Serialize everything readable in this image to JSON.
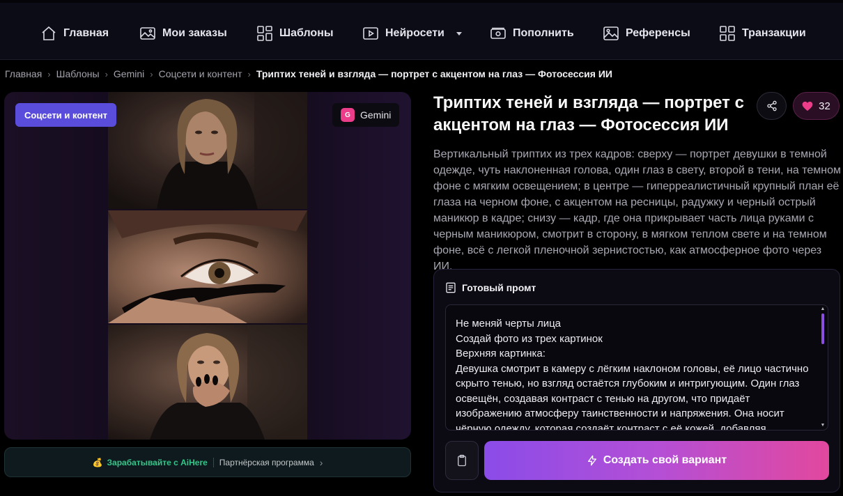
{
  "nav": {
    "items": [
      {
        "label": "Главная",
        "icon": "home-icon"
      },
      {
        "label": "Мои заказы",
        "icon": "image-icon"
      },
      {
        "label": "Шаблоны",
        "icon": "grid-icon"
      },
      {
        "label": "Нейросети",
        "icon": "play-icon",
        "has_dropdown": true
      },
      {
        "label": "Пополнить",
        "icon": "wallet-icon"
      },
      {
        "label": "Референсы",
        "icon": "picture-icon"
      },
      {
        "label": "Транзакции",
        "icon": "grid-icon"
      }
    ]
  },
  "breadcrumb": {
    "items": [
      "Главная",
      "Шаблоны",
      "Gemini",
      "Соцсети и контент"
    ],
    "current": "Триптих теней и взгляда — портрет с акцентом на глаз — Фотосессия ИИ"
  },
  "image_panel": {
    "category_chip": "Соцсети и контент",
    "model_badge": {
      "letter": "G",
      "label": "Gemini"
    },
    "partner": {
      "coin": "💰",
      "earn_label": "Зарабатывайте с AiHere",
      "program_label": "Партнёрская программа",
      "arrow": "›"
    }
  },
  "template": {
    "title": "Триптих теней и взгляда — портрет с акцентом на глаз — Фотосессия ИИ",
    "likes": "32",
    "description": "Вертикальный триптих из трех кадров: сверху — портрет девушки в темной одежде, чуть наклоненная голова, один глаз в свету, второй в тени, на темном фоне с мягким освещением; в центре — гиперреалистичный крупный план её глаза на черном фоне, с акцентом на ресницы, радужку и черный острый маникюр в кадре; снизу — кадр, где она прикрывает часть лица руками с черным маникюром, смотрит в сторону, в мягком теплом свете и на темном фоне, всё с легкой пленочной зернистостью, как атмосферное фото через ИИ."
  },
  "prompt": {
    "heading": "Готовый промт",
    "text": "Не меняй черты лица\nСоздай фото из трех картинок\nВерхняя картинка:\nДевушка смотрит в камеру с лёгким наклоном головы, её лицо частично скрыто тенью, но взгляд остаётся глубоким и интригующим. Один глаз освещён, создавая контраст с тенью на другом, что придаёт изображению атмосферу таинственности и напряжения. Она носит чёрную одежду, которая создаёт контраст с её кожей, добавляя",
    "create_label": "Создать свой вариант"
  },
  "colors": {
    "accent_purple": "#5b4ddb",
    "gradient_start": "#8b4ce8",
    "gradient_end": "#e2489e",
    "like_pink": "#ec3d8b",
    "partner_green": "#34c58a"
  }
}
